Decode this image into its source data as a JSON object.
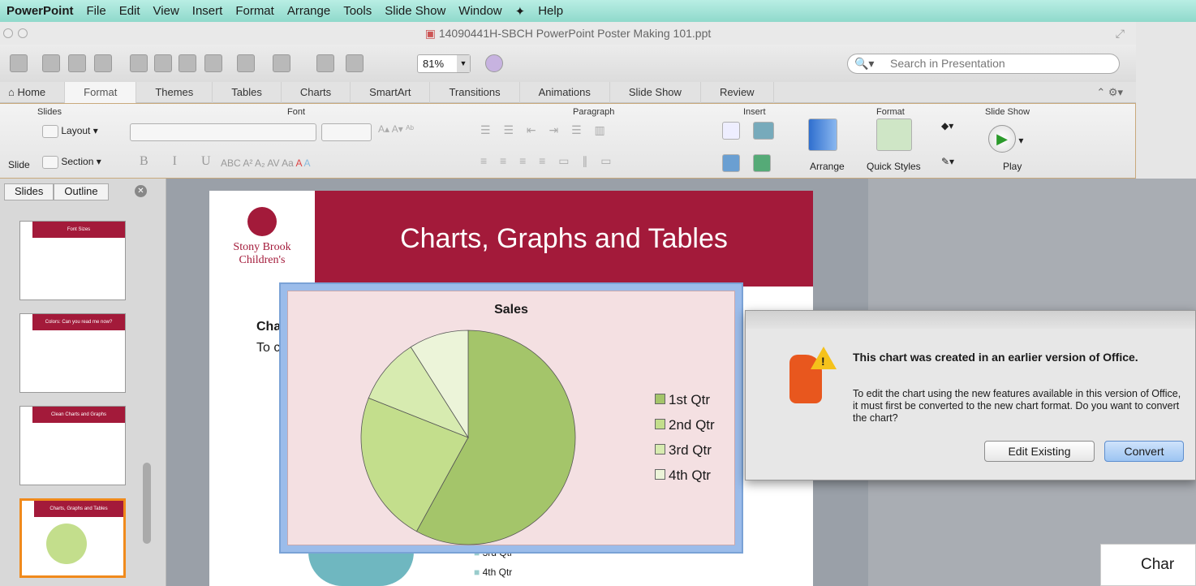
{
  "menu": {
    "app": "PowerPoint",
    "items": [
      "File",
      "Edit",
      "View",
      "Insert",
      "Format",
      "Arrange",
      "Tools",
      "Slide Show",
      "Window",
      "Help"
    ]
  },
  "window": {
    "title": "14090441H-SBCH PowerPoint Poster Making 101.ppt"
  },
  "toolbar": {
    "zoom": "81%",
    "search_placeholder": "Search in Presentation"
  },
  "ribbon": {
    "tabs": [
      "Home",
      "Format",
      "Themes",
      "Tables",
      "Charts",
      "SmartArt",
      "Transitions",
      "Animations",
      "Slide Show",
      "Review"
    ],
    "groups": {
      "slides": "Slides",
      "font": "Font",
      "paragraph": "Paragraph",
      "insert": "Insert",
      "format": "Format",
      "slideshow": "Slide Show"
    },
    "layout_label": "Layout",
    "section_label": "Section",
    "slide_label": "Slide",
    "arrange_label": "Arrange",
    "quick_styles_label": "Quick Styles",
    "play_label": "Play"
  },
  "left_panel": {
    "tabs": [
      "Slides",
      "Outline"
    ],
    "thumbs": [
      "Font Sizes",
      "Colors: Can you read me now?",
      "Clean Charts and Graphs",
      "Charts, Graphs and Tables"
    ]
  },
  "slide": {
    "title": "Charts, Graphs and Tables",
    "logo_line1": "Stony Brook",
    "logo_line2": "Children's",
    "body_heading": "Cha",
    "body_line": "To c",
    "bottom_legend": [
      "3rd Qtr",
      "4th Qtr"
    ]
  },
  "chart_data": {
    "type": "pie",
    "title": "Sales",
    "categories": [
      "1st Qtr",
      "2nd Qtr",
      "3rd Qtr",
      "4th Qtr"
    ],
    "values": [
      58,
      23,
      10,
      9
    ],
    "colors": [
      "#a4c56a",
      "#c3de8c",
      "#d7ebb0",
      "#ecf4d9"
    ]
  },
  "dialog": {
    "title": "This chart was created in an earlier version of Office.",
    "message": "To edit the chart using the new features available in this version of Office, it must first be converted to the new chart format. Do you want to convert the chart?",
    "edit_label": "Edit Existing",
    "convert_label": "Convert"
  },
  "corner_text": "Char"
}
